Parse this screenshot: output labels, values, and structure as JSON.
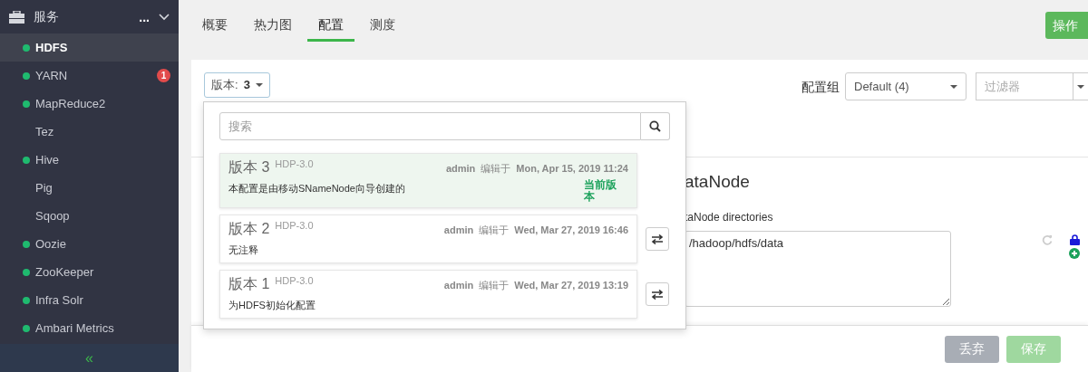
{
  "sidebar": {
    "title": "服务",
    "more": "...",
    "items": [
      {
        "label": "HDFS",
        "status_dot": true,
        "selected": true
      },
      {
        "label": "YARN",
        "status_dot": true,
        "selected": false,
        "badge": "1"
      },
      {
        "label": "MapReduce2",
        "status_dot": true,
        "selected": false
      },
      {
        "label": "Tez",
        "status_dot": false,
        "selected": false
      },
      {
        "label": "Hive",
        "status_dot": true,
        "selected": false
      },
      {
        "label": "Pig",
        "status_dot": false,
        "selected": false
      },
      {
        "label": "Sqoop",
        "status_dot": false,
        "selected": false
      },
      {
        "label": "Oozie",
        "status_dot": true,
        "selected": false
      },
      {
        "label": "ZooKeeper",
        "status_dot": true,
        "selected": false
      },
      {
        "label": "Infra Solr",
        "status_dot": true,
        "selected": false
      },
      {
        "label": "Ambari Metrics",
        "status_dot": true,
        "selected": false
      }
    ],
    "collapse": "«"
  },
  "tabs": [
    {
      "label": "概要",
      "selected": false
    },
    {
      "label": "热力图",
      "selected": false
    },
    {
      "label": "配置",
      "selected": true
    },
    {
      "label": "测度",
      "selected": false
    }
  ],
  "actions_button": "操作",
  "version_button": {
    "label": "版本:",
    "value": "3"
  },
  "config_group": {
    "label": "配置组",
    "value": "Default (4)"
  },
  "filter": {
    "placeholder": "过滤器"
  },
  "section": {
    "title": "ataNode",
    "field_label": "taNode directories",
    "field_value": "/hadoop/hdfs/data"
  },
  "version_menu": {
    "search_placeholder": "搜索",
    "versions": [
      {
        "title": "版本 3",
        "stack": "HDP-3.0",
        "user": "admin",
        "edited": "编辑于",
        "date": "Mon, Apr 15, 2019 11:24",
        "note": "本配置是由移动SNameNode向导创建的",
        "current": "当前版本",
        "selected": true
      },
      {
        "title": "版本 2",
        "stack": "HDP-3.0",
        "user": "admin",
        "edited": "编辑于",
        "date": "Wed, Mar 27, 2019 16:46",
        "note": "无注释",
        "selected": false
      },
      {
        "title": "版本 1",
        "stack": "HDP-3.0",
        "user": "admin",
        "edited": "编辑于",
        "date": "Wed, Mar 27, 2019 13:19",
        "note": "为HDFS初始化配置",
        "selected": false
      }
    ]
  },
  "footer": {
    "discard": "丢弃",
    "save": "保存",
    "save_disabled": true
  }
}
